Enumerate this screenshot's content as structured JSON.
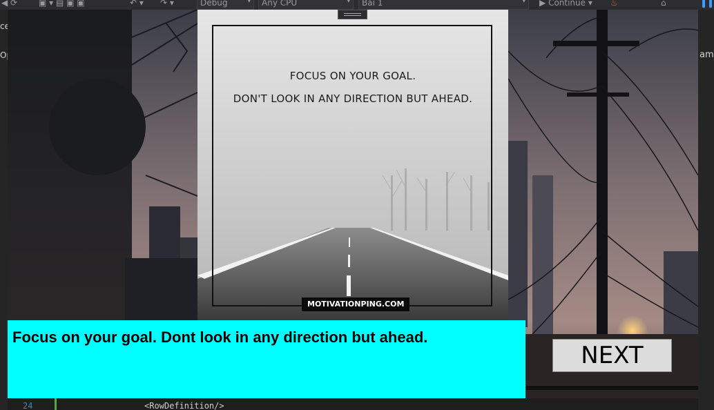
{
  "ide": {
    "config_combo": "Debug",
    "platform_combo": "Any CPU",
    "project_combo": "Bai 1",
    "continue_label": "Continue",
    "left_tab_1": "ce",
    "left_tab_2": "Op",
    "right_tab": "aml",
    "line_number": "24",
    "code_line": "<RowDefinition/>"
  },
  "quote_image": {
    "line1": "FOCUS ON YOUR GOAL.",
    "line2": "DON'T LOOK IN ANY DIRECTION BUT AHEAD.",
    "watermark": "MOTIVATIONPING.COM"
  },
  "caption": {
    "text": "Focus on your goal. Dont look in any direction but ahead.",
    "background": "#00ffff"
  },
  "next_button": {
    "label": "NEXT"
  },
  "icons": [
    "back-icon",
    "save-icon",
    "undo-icon",
    "redo-icon",
    "play-icon",
    "fire-icon",
    "home-icon",
    "pause-icon"
  ]
}
